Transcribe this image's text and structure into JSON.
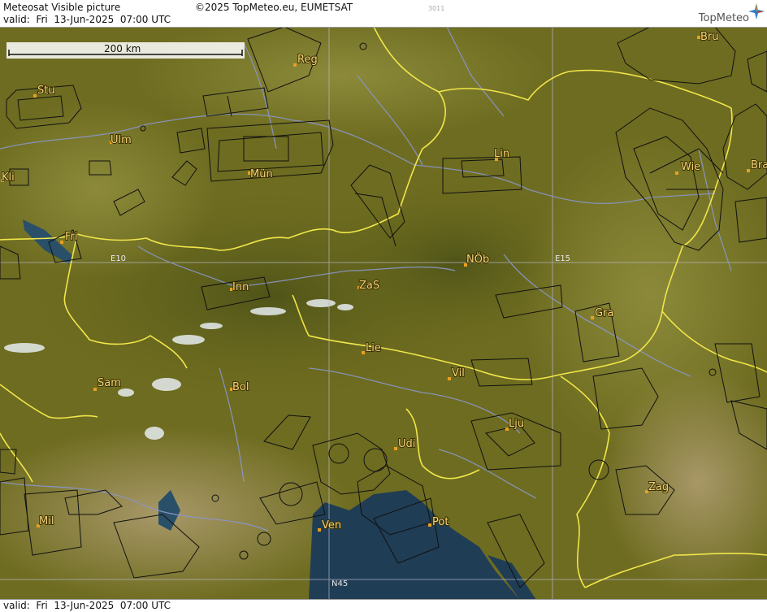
{
  "header": {
    "title": "Meteosat Visible picture",
    "valid": "valid:  Fri  13-Jun-2025  07:00 UTC",
    "copyright": "©2025 TopMeteo.eu, EUMETSAT",
    "code": "3011",
    "logo": "TopMeteo"
  },
  "footer": {
    "valid": "valid:  Fri  13-Jun-2025  07:00 UTC"
  },
  "scale": {
    "label": "200 km"
  },
  "grid": {
    "e10": "E10",
    "e15": "E15",
    "n45": "N45"
  },
  "cities": [
    {
      "code": "Reg"
    },
    {
      "code": "Bru"
    },
    {
      "code": "Stu"
    },
    {
      "code": "Ulm"
    },
    {
      "code": "Mün"
    },
    {
      "code": "Lin"
    },
    {
      "code": "Wie"
    },
    {
      "code": "Bra"
    },
    {
      "code": "Kli"
    },
    {
      "code": "Fri"
    },
    {
      "code": "NÖb"
    },
    {
      "code": "Inn"
    },
    {
      "code": "ZaS"
    },
    {
      "code": "Gra"
    },
    {
      "code": "Lie"
    },
    {
      "code": "Vil"
    },
    {
      "code": "Sam"
    },
    {
      "code": "Bol"
    },
    {
      "code": "Lju"
    },
    {
      "code": "Udi"
    },
    {
      "code": "Zag"
    },
    {
      "code": "Mil"
    },
    {
      "code": "Ven"
    },
    {
      "code": "Pot"
    }
  ],
  "colors": {
    "terrain": "#6b6a1e",
    "border": "#f0e64a",
    "airspace": "#111111",
    "sea": "#1f3d55",
    "city": "#e8a020"
  }
}
